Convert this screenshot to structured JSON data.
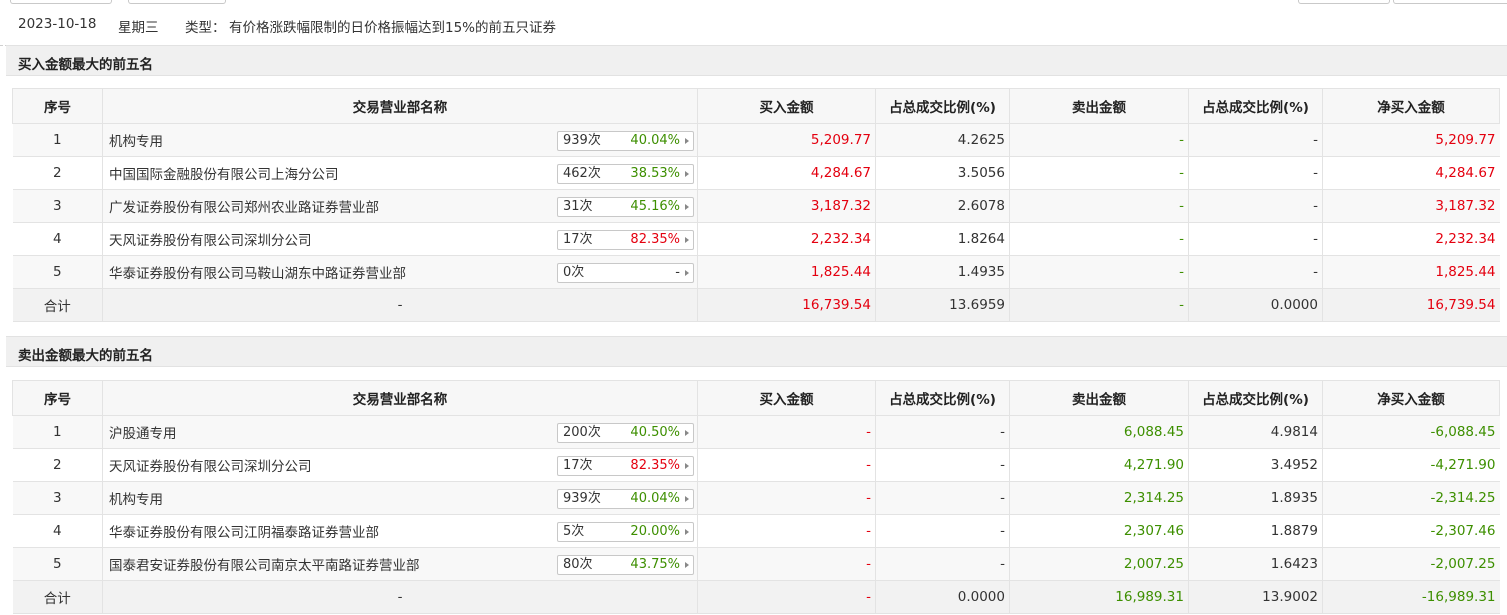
{
  "info": {
    "date": "2023-10-18",
    "weekday": "星期三",
    "type_label": "类型：",
    "type_text": "有价格涨跌幅限制的日价格振幅达到15%的前五只证券"
  },
  "colors": {
    "up": "#e4000f",
    "down": "#3d8f00",
    "header_bg": "#f7f7f7"
  },
  "headers": [
    "序号",
    "交易营业部名称",
    "买入金额",
    "占总成交比例(%)",
    "卖出金额",
    "占总成交比例(%)",
    "净买入金额"
  ],
  "buy_section": {
    "title": "买入金额最大的前五名",
    "rows": [
      {
        "idx": "1",
        "name": "机构专用",
        "count": "939次",
        "rate": "40.04%",
        "rate_color": "green",
        "buy": "5,209.77",
        "buy_pct": "4.2625",
        "sell": "-",
        "sell_pct": "-",
        "net": "5,209.77"
      },
      {
        "idx": "2",
        "name": "中国国际金融股份有限公司上海分公司",
        "count": "462次",
        "rate": "38.53%",
        "rate_color": "green",
        "buy": "4,284.67",
        "buy_pct": "3.5056",
        "sell": "-",
        "sell_pct": "-",
        "net": "4,284.67"
      },
      {
        "idx": "3",
        "name": "广发证券股份有限公司郑州农业路证券营业部",
        "count": "31次",
        "rate": "45.16%",
        "rate_color": "green",
        "buy": "3,187.32",
        "buy_pct": "2.6078",
        "sell": "-",
        "sell_pct": "-",
        "net": "3,187.32"
      },
      {
        "idx": "4",
        "name": "天风证券股份有限公司深圳分公司",
        "count": "17次",
        "rate": "82.35%",
        "rate_color": "red",
        "buy": "2,232.34",
        "buy_pct": "1.8264",
        "sell": "-",
        "sell_pct": "-",
        "net": "2,232.34"
      },
      {
        "idx": "5",
        "name": "华泰证券股份有限公司马鞍山湖东中路证券营业部",
        "count": "0次",
        "rate": "-",
        "rate_color": "dash",
        "buy": "1,825.44",
        "buy_pct": "1.4935",
        "sell": "-",
        "sell_pct": "-",
        "net": "1,825.44"
      }
    ],
    "total": {
      "idx": "合计",
      "name": "-",
      "buy": "16,739.54",
      "buy_pct": "13.6959",
      "sell": "-",
      "sell_pct": "0.0000",
      "net": "16,739.54"
    }
  },
  "sell_section": {
    "title": "卖出金额最大的前五名",
    "rows": [
      {
        "idx": "1",
        "name": "沪股通专用",
        "count": "200次",
        "rate": "40.50%",
        "rate_color": "green",
        "buy": "-",
        "buy_pct": "-",
        "sell": "6,088.45",
        "sell_pct": "4.9814",
        "net": "-6,088.45"
      },
      {
        "idx": "2",
        "name": "天风证券股份有限公司深圳分公司",
        "count": "17次",
        "rate": "82.35%",
        "rate_color": "red",
        "buy": "-",
        "buy_pct": "-",
        "sell": "4,271.90",
        "sell_pct": "3.4952",
        "net": "-4,271.90"
      },
      {
        "idx": "3",
        "name": "机构专用",
        "count": "939次",
        "rate": "40.04%",
        "rate_color": "green",
        "buy": "-",
        "buy_pct": "-",
        "sell": "2,314.25",
        "sell_pct": "1.8935",
        "net": "-2,314.25"
      },
      {
        "idx": "4",
        "name": "华泰证券股份有限公司江阴福泰路证券营业部",
        "count": "5次",
        "rate": "20.00%",
        "rate_color": "green",
        "buy": "-",
        "buy_pct": "-",
        "sell": "2,307.46",
        "sell_pct": "1.8879",
        "net": "-2,307.46"
      },
      {
        "idx": "5",
        "name": "国泰君安证券股份有限公司南京太平南路证券营业部",
        "count": "80次",
        "rate": "43.75%",
        "rate_color": "green",
        "buy": "-",
        "buy_pct": "-",
        "sell": "2,007.25",
        "sell_pct": "1.6423",
        "net": "-2,007.25"
      }
    ],
    "total": {
      "idx": "合计",
      "name": "-",
      "buy": "-",
      "buy_pct": "0.0000",
      "sell": "16,989.31",
      "sell_pct": "13.9002",
      "net": "-16,989.31"
    }
  }
}
